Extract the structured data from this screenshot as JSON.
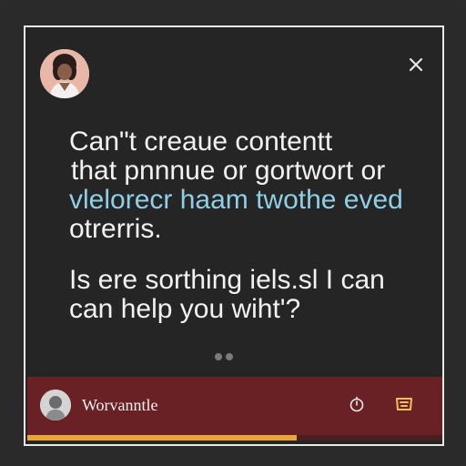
{
  "dialog": {
    "message_lines": [
      "Can\"t creaue contentt",
      "that pnnnue or gortwort or",
      "vlelorecr haam twothe eved",
      "otrerris.",
      "Is ere sorthing iels.sl I can",
      "can help you wiht'?"
    ],
    "close_icon": "close-icon",
    "top_avatar_icon": "avatar-icon"
  },
  "footer": {
    "label": "Worvanntle",
    "icons": [
      "timer-icon",
      "card-icon"
    ],
    "progress": 0.65
  },
  "colors": {
    "background": "#2b2b2b",
    "card": "#252525",
    "border": "#e9e9e9",
    "text": "#f2f2f2",
    "highlight": "#8fcfe6",
    "footer_bg": "#6a2125",
    "accent": "#e7a73b",
    "icon_yellow": "#f2c05b"
  }
}
